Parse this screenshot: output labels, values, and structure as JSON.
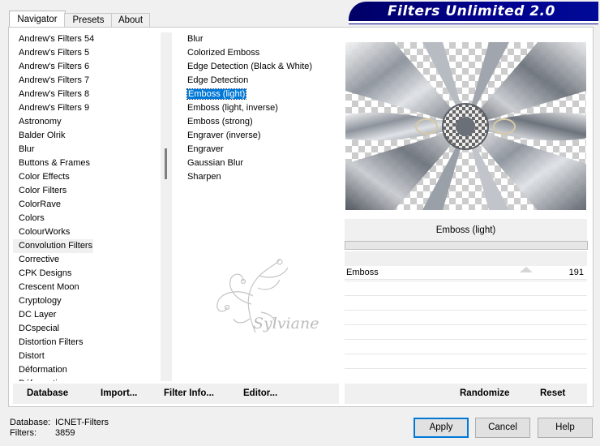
{
  "tabs": [
    "Navigator",
    "Presets",
    "About"
  ],
  "banner_title": "Filters Unlimited 2.0",
  "categories": [
    "Andrew's Filters 54",
    "Andrew's Filters 5",
    "Andrew's Filters 6",
    "Andrew's Filters 7",
    "Andrew's Filters 8",
    "Andrew's Filters 9",
    "Astronomy",
    "Balder Olrik",
    "Blur",
    "Buttons & Frames",
    "Color Effects",
    "Color Filters",
    "ColorRave",
    "Colors",
    "ColourWorks",
    "Convolution Filters",
    "Corrective",
    "CPK Designs",
    "Crescent Moon",
    "Cryptology",
    "DC Layer",
    "DCspecial",
    "Distortion Filters",
    "Distort",
    "Déformation",
    "Déformation"
  ],
  "selected_category": "Convolution Filters",
  "filters": [
    "Blur",
    "Colorized Emboss",
    "Edge Detection (Black & White)",
    "Edge Detection",
    "Emboss (light)",
    "Emboss (light, inverse)",
    "Emboss (strong)",
    "Engraver (inverse)",
    "Engraver",
    "Gaussian Blur",
    "Sharpen"
  ],
  "selected_filter": "Emboss (light)",
  "watermark_text": "Sylviane",
  "left_buttons": {
    "database": "Database",
    "import": "Import...",
    "filter_info": "Filter Info...",
    "editor": "Editor..."
  },
  "right_buttons": {
    "randomize": "Randomize",
    "reset": "Reset"
  },
  "effect_name": "Emboss (light)",
  "parameter": {
    "label": "Emboss",
    "value": "191"
  },
  "footer": {
    "database_label": "Database:",
    "database_value": "ICNET-Filters",
    "filters_label": "Filters:",
    "filters_value": "3859"
  },
  "dialog_buttons": {
    "apply": "Apply",
    "cancel": "Cancel",
    "help": "Help"
  },
  "colors": {
    "banner": "#00008f",
    "selection": "#0078d7",
    "window_bg": "#f0f0f0"
  }
}
